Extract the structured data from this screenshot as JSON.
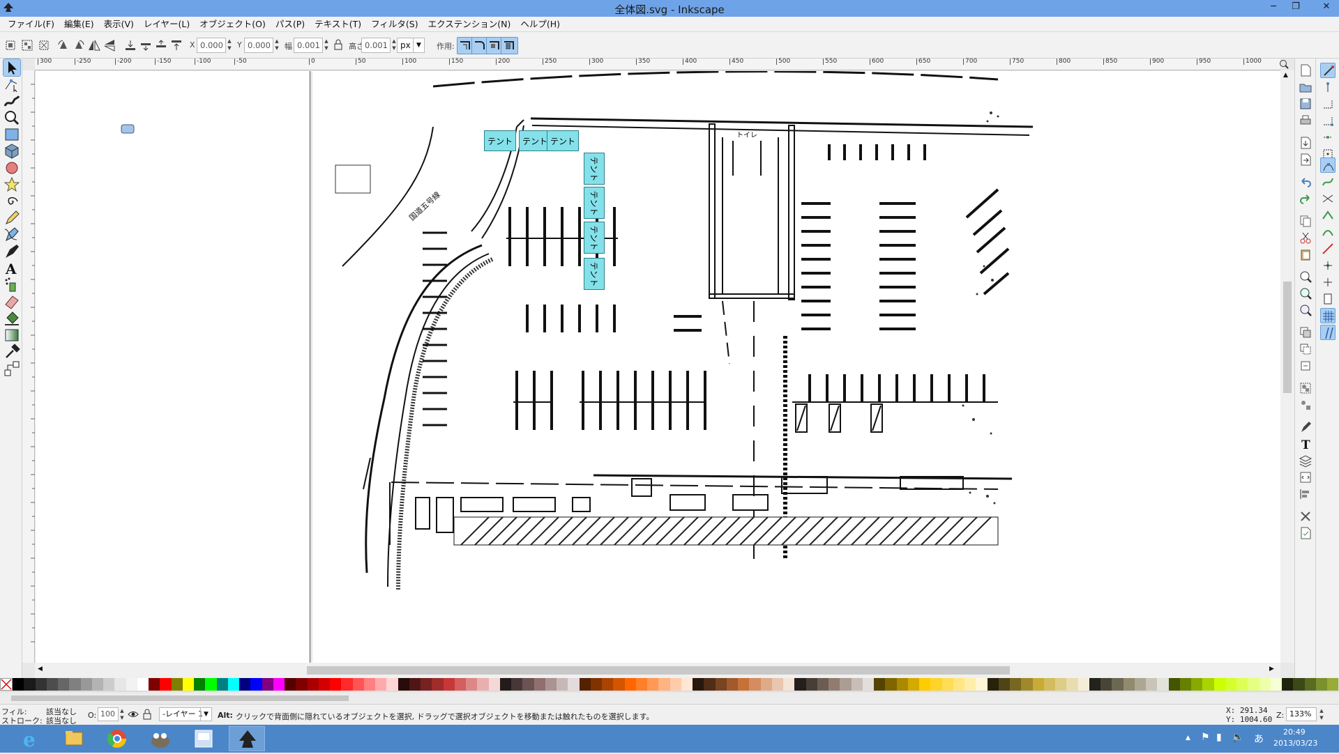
{
  "window": {
    "title": "全体図.svg - Inkscape",
    "minimize": "─",
    "restore": "❐",
    "close": "✕"
  },
  "menu": [
    "ファイル(F)",
    "編集(E)",
    "表示(V)",
    "レイヤー(L)",
    "オブジェクト(O)",
    "パス(P)",
    "テキスト(T)",
    "フィルタ(S)",
    "エクステンション(N)",
    "ヘルプ(H)"
  ],
  "toolbar": {
    "x_label": "X",
    "x_value": "0.000",
    "y_label": "Y",
    "y_value": "0.000",
    "w_label": "幅",
    "w_value": "0.001",
    "h_label": "高さ",
    "h_value": "0.001",
    "unit": "px",
    "affect_label": "作用:"
  },
  "ruler": {
    "ticks": [
      "300",
      "-250",
      "-200",
      "-150",
      "-100",
      "-50",
      "0",
      "50",
      "100",
      "150",
      "200",
      "250",
      "300",
      "350",
      "400",
      "450",
      "500",
      "550",
      "600",
      "650",
      "700",
      "750",
      "800",
      "850",
      "900",
      "950",
      "1000"
    ]
  },
  "canvas": {
    "tents_horizontal": [
      "テント",
      "テント",
      "テント"
    ],
    "tents_vertical": [
      "テント",
      "テント",
      "テント",
      "テント"
    ],
    "road_label": "国道五号線",
    "toilet_label": "トイレ"
  },
  "palette": [
    "#000000",
    "#1a1a1a",
    "#333333",
    "#4d4d4d",
    "#666666",
    "#808080",
    "#999999",
    "#b3b3b3",
    "#cccccc",
    "#e6e6e6",
    "#f2f2f2",
    "#ffffff",
    "#800000",
    "#ff0000",
    "#808000",
    "#ffff00",
    "#008000",
    "#00ff00",
    "#008080",
    "#00ffff",
    "#000080",
    "#0000ff",
    "#800080",
    "#ff00ff",
    "#550000",
    "#800000",
    "#aa0000",
    "#d40000",
    "#ff0000",
    "#ff2a2a",
    "#ff5555",
    "#ff8080",
    "#ffaaaa",
    "#ffd5d5",
    "#280b0b",
    "#501616",
    "#782121",
    "#a02c2c",
    "#c83737",
    "#d35f5f",
    "#de8787",
    "#e9afaf",
    "#f4d7d7",
    "#241c1c",
    "#483737",
    "#6c5353",
    "#916f6f",
    "#ac9393",
    "#c8b7b7",
    "#e3dbdb",
    "#552200",
    "#803300",
    "#aa4400",
    "#d45500",
    "#ff6600",
    "#ff7f2a",
    "#ff9955",
    "#ffb380",
    "#ffccaa",
    "#ffe6d5",
    "#28170b",
    "#502d16",
    "#784421",
    "#a05a2c",
    "#c87137",
    "#d38d5f",
    "#deaa87",
    "#e9c6af",
    "#f4e3d7",
    "#241f1c",
    "#483e37",
    "#6c5d53",
    "#917c6f",
    "#ac9d93",
    "#c8beb7",
    "#e3dedb",
    "#554400",
    "#806600",
    "#aa8800",
    "#d4aa00",
    "#ffcc00",
    "#ffd42a",
    "#ffdd55",
    "#ffe680",
    "#ffeeaa",
    "#fff6d5",
    "#28220b",
    "#504416",
    "#786721",
    "#a0892c",
    "#c8ab37",
    "#d3bc5f",
    "#decd87",
    "#e9ddaf",
    "#f4eed7",
    "#24221c",
    "#484537",
    "#6c6753",
    "#918a6f",
    "#aca793",
    "#c8c4b7",
    "#e3e2db",
    "#445500",
    "#668000",
    "#88aa00",
    "#aad400",
    "#ccff00",
    "#d4ff2a",
    "#ddff55",
    "#e5ff80",
    "#eeffaa",
    "#f6ffd5",
    "#1e240b",
    "#3c4816",
    "#586c21",
    "#7a912c",
    "#98ac37"
  ],
  "status": {
    "fill_label": "フィル:",
    "fill_value": "該当なし",
    "stroke_label": "ストローク:",
    "stroke_value": "該当なし",
    "opacity_label": "O:",
    "opacity_value": "100",
    "layer": "-レイヤー 1",
    "alt_key": "Alt:",
    "message": "クリックで背面側に隠れているオブジェクトを選択, ドラッグで選択オブジェクトを移動または触れたものを選択します。",
    "x_coord": "X: 291.34",
    "y_coord": "Y: 1004.60",
    "zoom_label": "Z:",
    "zoom_value": "133%"
  },
  "taskbar": {
    "time": "20:49",
    "date": "2013/03/23",
    "ime": "あ"
  }
}
